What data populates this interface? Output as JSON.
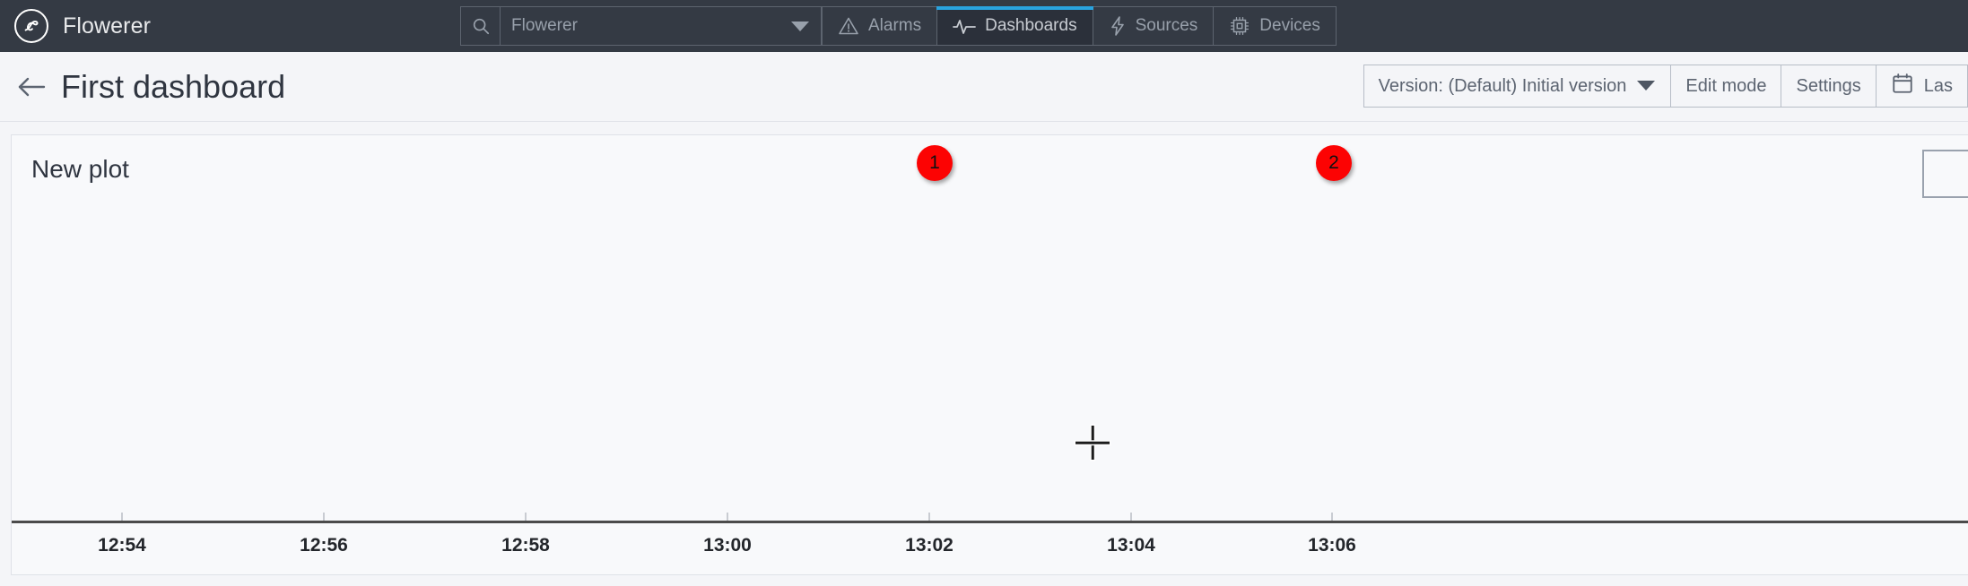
{
  "topbar": {
    "brand_name": "Flowerer",
    "logo_icon": "flowerer-circle-logo",
    "search": {
      "icon": "search-icon",
      "placeholder": "Flowerer",
      "value": "",
      "caret_icon": "chevron-down-icon"
    },
    "tabs": [
      {
        "label": "Alarms",
        "icon": "warning-triangle-icon",
        "active": false
      },
      {
        "label": "Dashboards",
        "icon": "activity-pulse-icon",
        "active": true
      },
      {
        "label": "Sources",
        "icon": "lightning-bolt-icon",
        "active": false
      },
      {
        "label": "Devices",
        "icon": "cpu-chip-icon",
        "active": false
      }
    ],
    "active_tab_accent": "#29a3df",
    "background": "#343a44"
  },
  "titlebar": {
    "back_icon": "back-arrow-icon",
    "title": "First dashboard",
    "toolbar": [
      {
        "label": "Version: (Default) Initial version",
        "icon": "chevron-down-icon",
        "name": "version-selector"
      },
      {
        "label": "Edit mode",
        "icon": "",
        "name": "edit-mode-button"
      },
      {
        "label": "Settings",
        "icon": "",
        "name": "settings-button"
      },
      {
        "label": "Las",
        "icon": "calendar-icon",
        "name": "time-range-button"
      }
    ]
  },
  "annotations": [
    {
      "number": "1",
      "color": "#fc0303"
    },
    {
      "number": "2",
      "color": "#fc0303"
    }
  ],
  "panel": {
    "title": "New plot",
    "corner_button_name": "panel-menu-button"
  },
  "chart_data": {
    "type": "line",
    "title": "New plot",
    "xlabel": "",
    "ylabel": "",
    "grid": false,
    "legend": null,
    "series": [],
    "x_tick_labels": [
      "12:54",
      "12:56",
      "12:58",
      "13:00",
      "13:02",
      "13:04",
      "13:06"
    ],
    "x_tick_positions": [
      123,
      348,
      573,
      798,
      1023,
      1248,
      1472
    ],
    "note": "Empty plot — no data series rendered; only the time axis is drawn."
  }
}
